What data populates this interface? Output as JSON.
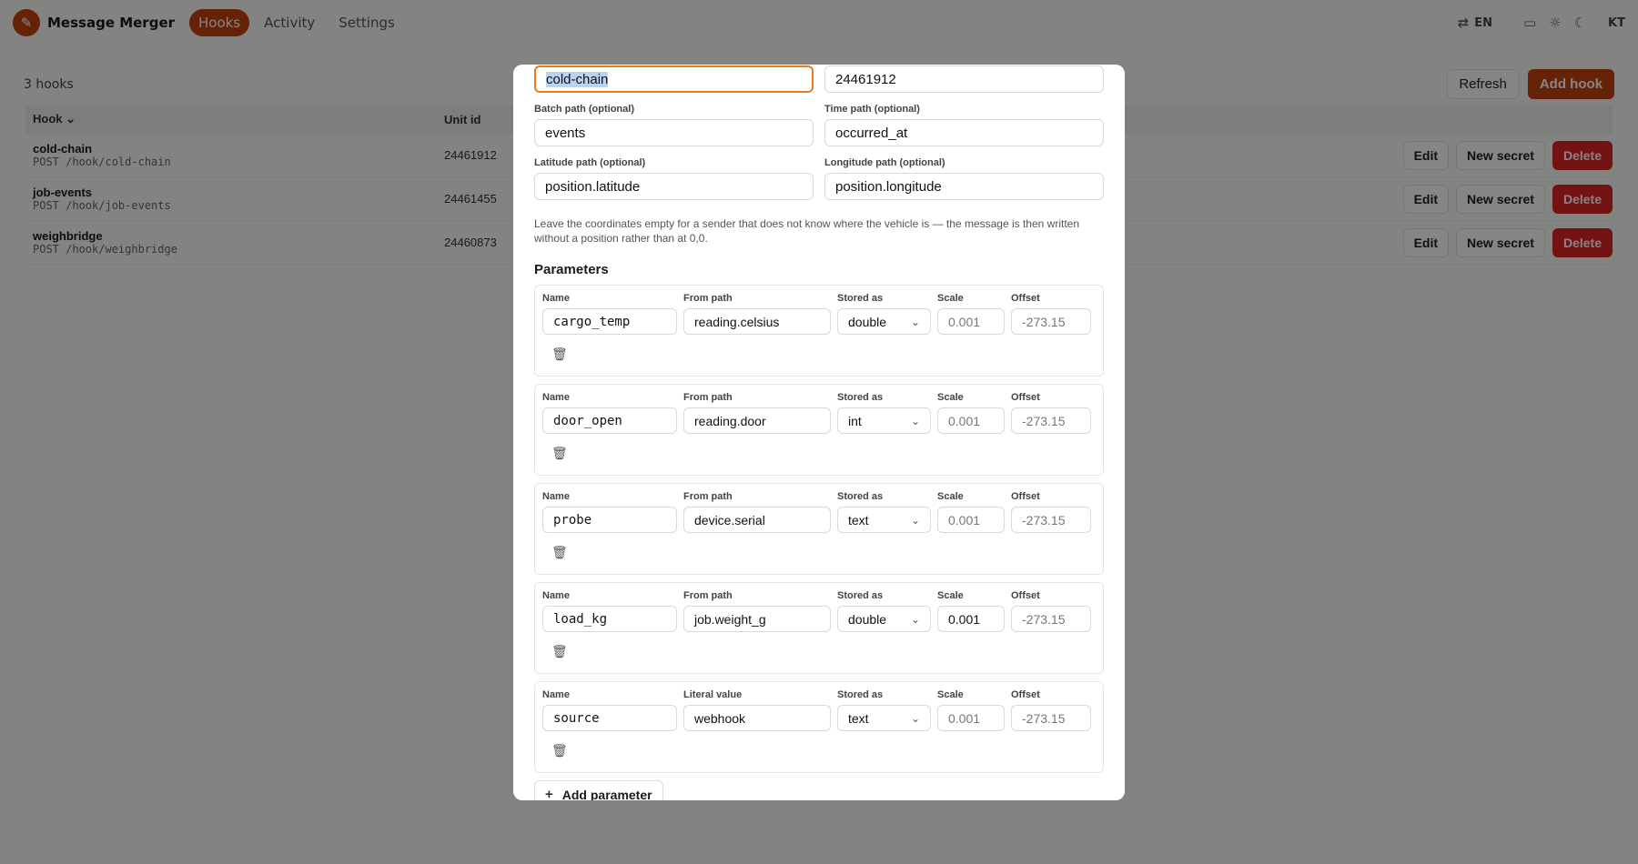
{
  "app": {
    "title": "Message Merger",
    "nav": [
      {
        "label": "Hooks",
        "active": true
      },
      {
        "label": "Activity",
        "active": false
      },
      {
        "label": "Settings",
        "active": false
      }
    ],
    "lang": "EN",
    "avatar": "KT",
    "accent": "#c2410c"
  },
  "toolbar": {
    "count": "3 hooks",
    "refresh": "Refresh",
    "add": "Add hook"
  },
  "table": {
    "headers": {
      "hook": "Hook",
      "unit": "Unit id"
    },
    "rows": [
      {
        "name": "cold-chain",
        "path": "POST /hook/cold-chain",
        "unit": "24461912"
      },
      {
        "name": "job-events",
        "path": "POST /hook/job-events",
        "unit": "24461455"
      },
      {
        "name": "weighbridge",
        "path": "POST /hook/weighbridge",
        "unit": "24460873"
      }
    ],
    "actions": {
      "edit": "Edit",
      "secret": "New secret",
      "delete": "Delete"
    }
  },
  "modal": {
    "name_value": "cold-chain",
    "unit_value": "24461912",
    "batch_label": "Batch path (optional)",
    "batch_value": "events",
    "time_label": "Time path (optional)",
    "time_value": "occurred_at",
    "lat_label": "Latitude path (optional)",
    "lat_value": "position.latitude",
    "lon_label": "Longitude path (optional)",
    "lon_value": "position.longitude",
    "help": "Leave the coordinates empty for a sender that does not know where the vehicle is — the message is then written without a position rather than at 0,0.",
    "params_title": "Parameters",
    "labels": {
      "name": "Name",
      "from": "From path",
      "literal": "Literal value",
      "stored": "Stored as",
      "scale": "Scale",
      "offset": "Offset"
    },
    "params": [
      {
        "name": "cargo_temp",
        "source_label": "From path",
        "source": "reading.celsius",
        "stored": "double",
        "scale": "0.001",
        "offset": "-273.15"
      },
      {
        "name": "door_open",
        "source_label": "From path",
        "source": "reading.door",
        "stored": "int",
        "scale": "0.001",
        "offset": "-273.15"
      },
      {
        "name": "probe",
        "source_label": "From path",
        "source": "device.serial",
        "stored": "text",
        "scale": "0.001",
        "offset": "-273.15"
      },
      {
        "name": "load_kg",
        "source_label": "From path",
        "source": "job.weight_g",
        "stored": "double",
        "scale": "0.001",
        "offset": "-273.15"
      },
      {
        "name": "source",
        "source_label": "Literal value",
        "source": "webhook",
        "stored": "text",
        "scale": "0.001",
        "offset": "-273.15"
      }
    ],
    "add_param": "Add parameter"
  }
}
